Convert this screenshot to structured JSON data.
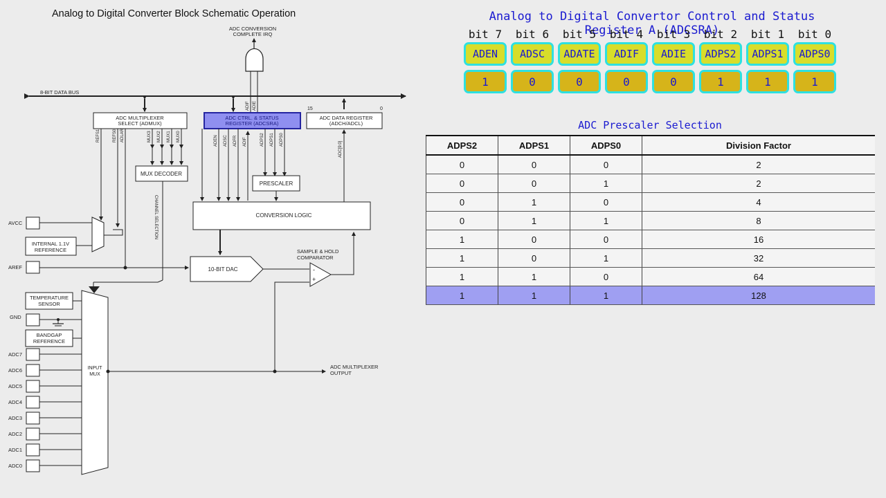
{
  "schematic": {
    "title": "Analog to Digital Converter Block Schematic Operation",
    "irq_label_1": "ADC CONVERSION",
    "irq_label_2": "COMPLETE IRQ",
    "data_bus": "8-BIT DATA BUS",
    "admux_1": "ADC MULTIPLEXER",
    "admux_2": "SELECT (ADMUX)",
    "adcsra_1": "ADC CTRL. & STATUS",
    "adcsra_2": "REGISTER (ADCSRA)",
    "adcdata_1": "ADC DATA REGISTER",
    "adcdata_2": "(ADCH/ADCL)",
    "bit15": "15",
    "bit0": "0",
    "adif": "ADIF",
    "adie": "ADIE",
    "refs1": "REFS1",
    "refs0": "REFS0",
    "adlar": "ADLAR",
    "mux3": "MUX3",
    "mux2": "MUX2",
    "mux1": "MUX1",
    "mux0": "MUX0",
    "aden": "ADEN",
    "adsc": "ADSC",
    "adfr": "ADFR",
    "adif2": "ADIF",
    "adps2": "ADPS2",
    "adps1": "ADPS1",
    "adps0": "ADPS0",
    "adc_bits": "ADC[9:0]",
    "mux_decoder": "MUX DECODER",
    "prescaler": "PRESCALER",
    "conversion_logic": "CONVERSION LOGIC",
    "channel_selection": "CHANNEL SELECTION",
    "avcc": "AVCC",
    "internal_ref_1": "INTERNAL 1.1V",
    "internal_ref_2": "REFERENCE",
    "aref": "AREF",
    "dac": "10-BIT DAC",
    "sh_1": "SAMPLE & HOLD",
    "sh_2": "COMPARATOR",
    "minus": "-",
    "plus": "+",
    "temp_1": "TEMPERATURE",
    "temp_2": "SENSOR",
    "gnd": "GND",
    "bandgap_1": "BANDGAP",
    "bandgap_2": "REFERENCE",
    "input_mux_1": "INPUT",
    "input_mux_2": "MUX",
    "mux_output_1": "ADC MULTIPLEXER",
    "mux_output_2": "OUTPUT",
    "adc_inputs": [
      "ADC7",
      "ADC6",
      "ADC5",
      "ADC4",
      "ADC3",
      "ADC2",
      "ADC1",
      "ADC0"
    ]
  },
  "register": {
    "title": "Analog to Digital Convertor Control and Status Register A (ADCSRA)",
    "bit_labels": [
      "bit 7",
      "bit 6",
      "bit 5",
      "bit 4",
      "bit 3",
      "bit 2",
      "bit 1",
      "bit 0"
    ],
    "names": [
      "ADEN",
      "ADSC",
      "ADATE",
      "ADIF",
      "ADIE",
      "ADPS2",
      "ADPS1",
      "ADPS0"
    ],
    "values": [
      "1",
      "0",
      "0",
      "0",
      "0",
      "1",
      "1",
      "1"
    ]
  },
  "prescaler_table": {
    "title": "ADC Prescaler Selection",
    "headers": [
      "ADPS2",
      "ADPS1",
      "ADPS0",
      "Division Factor"
    ],
    "rows": [
      [
        "0",
        "0",
        "0",
        "2"
      ],
      [
        "0",
        "0",
        "1",
        "2"
      ],
      [
        "0",
        "1",
        "0",
        "4"
      ],
      [
        "0",
        "1",
        "1",
        "8"
      ],
      [
        "1",
        "0",
        "0",
        "16"
      ],
      [
        "1",
        "0",
        "1",
        "32"
      ],
      [
        "1",
        "1",
        "0",
        "64"
      ],
      [
        "1",
        "1",
        "1",
        "128"
      ]
    ],
    "highlighted_row": 7,
    "highlight_color": "#9f9ff2"
  },
  "colors": {
    "register_title": "#1a1ad0",
    "cell_border": "#2ee0e0",
    "cell_fill": "#d6b41a",
    "name_fill": "#d8dd2a",
    "adcsra_block": "#8f8ff0"
  }
}
